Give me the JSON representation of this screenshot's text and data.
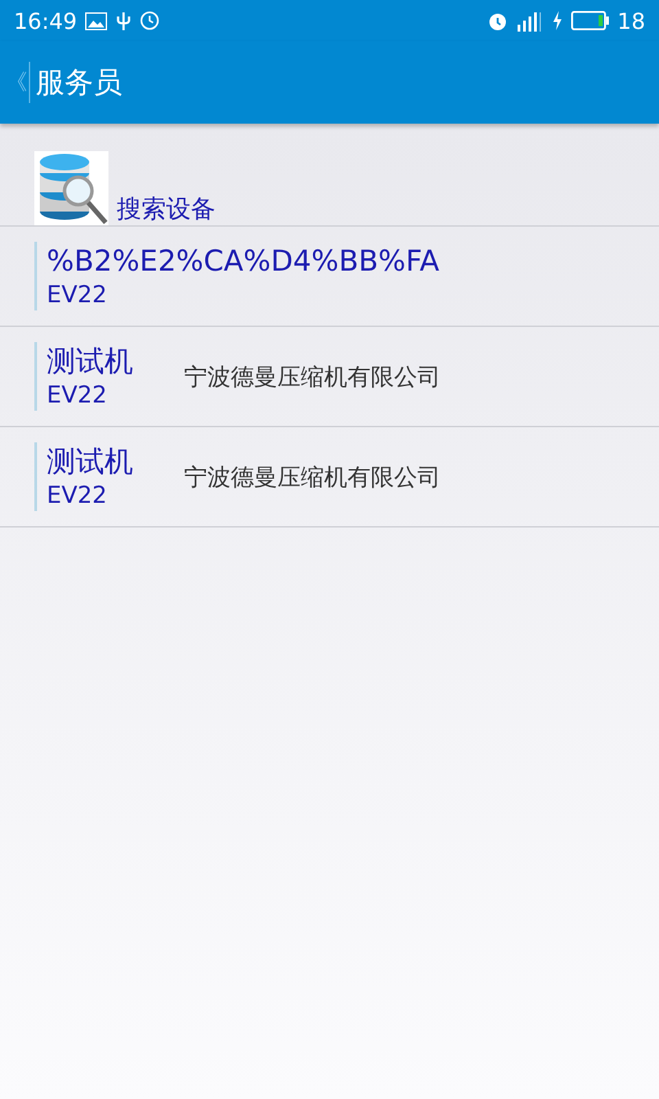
{
  "status_bar": {
    "time": "16:49",
    "battery_text": "18"
  },
  "app_bar": {
    "back": "《",
    "title": "服务员"
  },
  "search": {
    "label": "搜索设备"
  },
  "devices": [
    {
      "name": "%B2%E2%CA%D4%BB%FA",
      "model": "EV22"
    },
    {
      "name": "测试机",
      "model": "EV22",
      "company": "宁波德曼压缩机有限公司"
    },
    {
      "name": "测试机",
      "model": "EV22",
      "company": "宁波德曼压缩机有限公司"
    }
  ]
}
